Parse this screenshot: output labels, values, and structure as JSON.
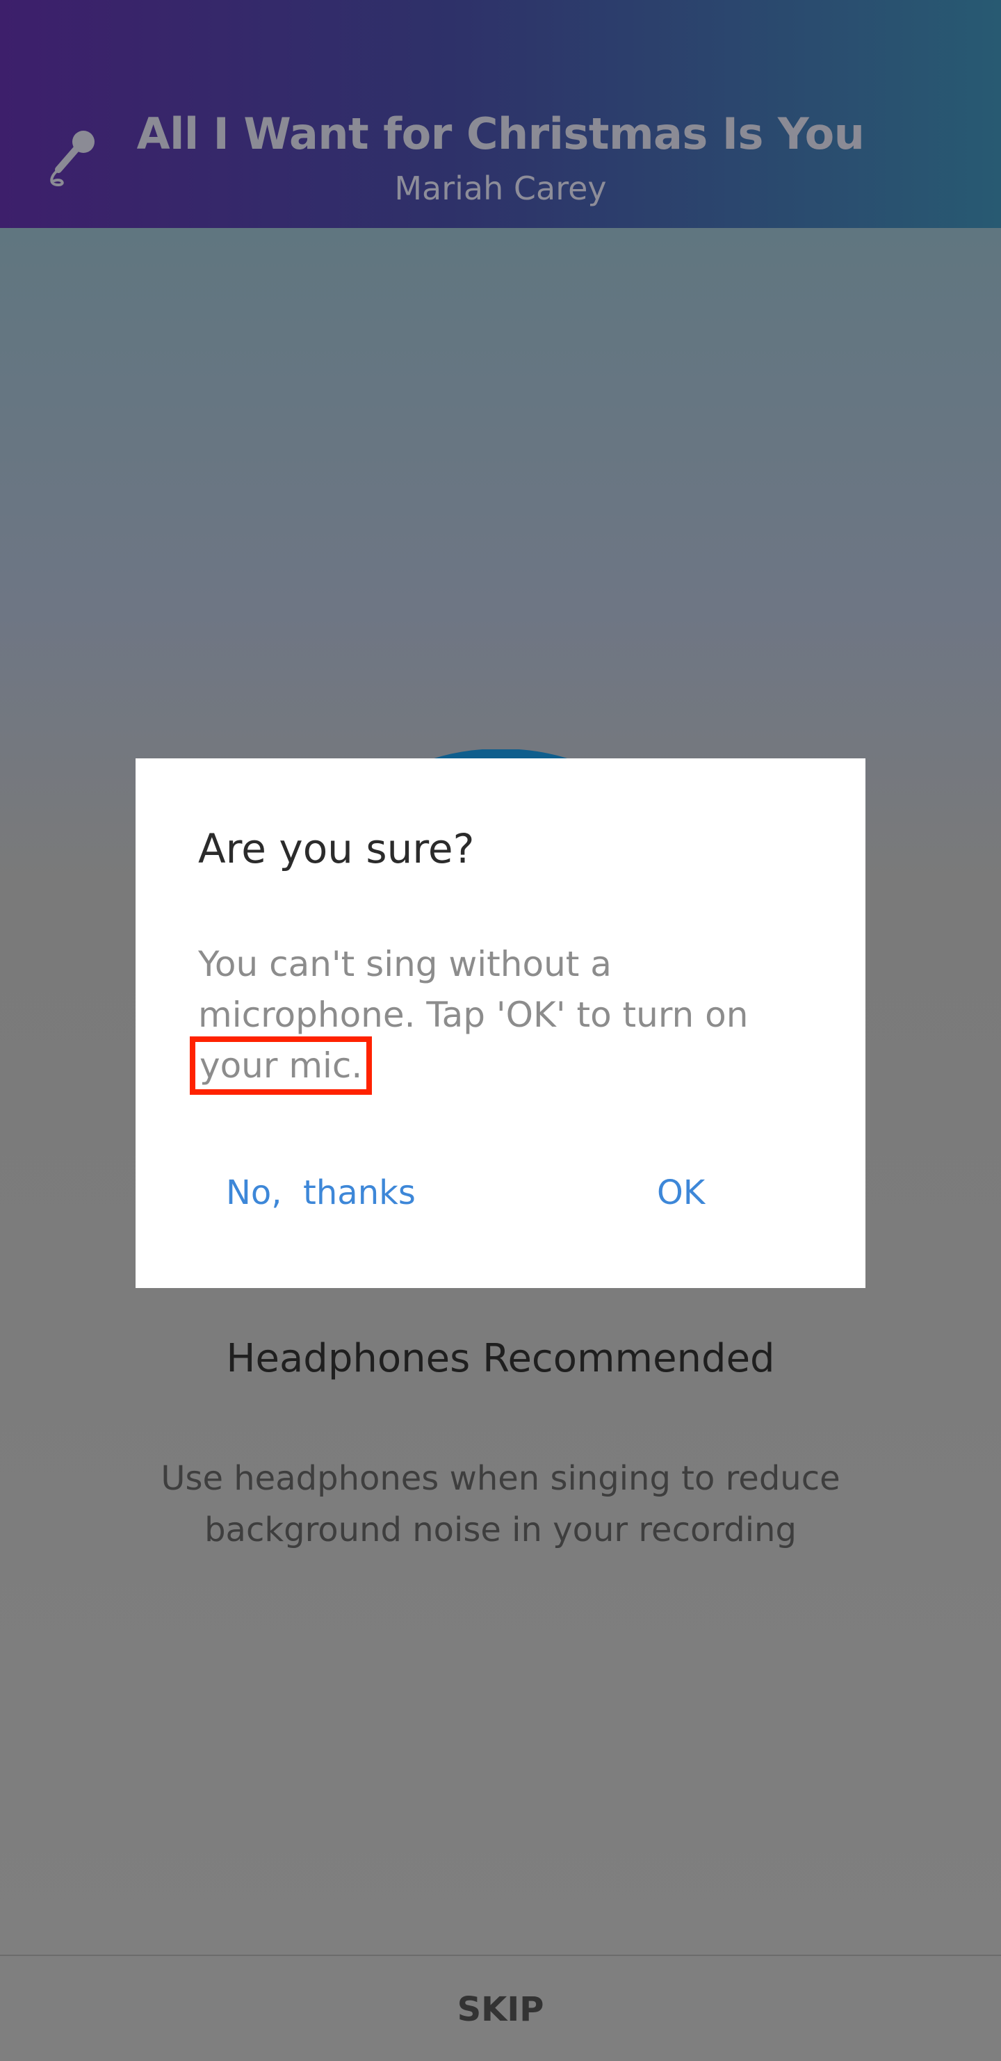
{
  "header": {
    "song_title": "All I Want for Christmas Is You",
    "artist": "Mariah Carey",
    "icon": "microphone-icon"
  },
  "main": {
    "illustration": "headphones-icon",
    "heading": "Headphones Recommended",
    "description_line1": "Use headphones when singing to reduce",
    "description_line2": "background noise in your recording"
  },
  "dialog": {
    "title": "Are you sure?",
    "message_line1": "You can't sing without a",
    "message_line2": "microphone. Tap 'OK' to turn on",
    "message_highlight": "your mic.",
    "negative_label": "No,  thanks",
    "positive_label": "OK"
  },
  "footer": {
    "skip_label": "SKIP"
  },
  "colors": {
    "dialog_button": "#3d87d8",
    "highlight_box": "#ff2200",
    "headphones_stroke": "#0f5e8d"
  }
}
